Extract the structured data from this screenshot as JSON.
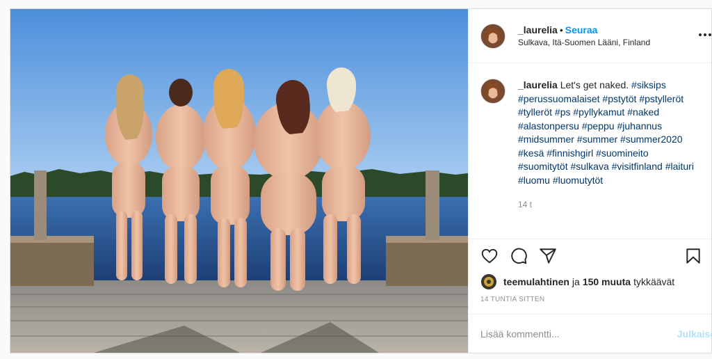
{
  "header": {
    "username": "_laurelia",
    "separator": "•",
    "follow_label": "Seuraa",
    "location": "Sulkava, Itä-Suomen Lääni, Finland",
    "more_icon": "more-horizontal-icon"
  },
  "caption": {
    "username": "_laurelia",
    "text": "Let's get naked.",
    "hashtags": [
      "#siksips",
      "#perussuomalaiset",
      "#pstytöt",
      "#pstylleröt",
      "#tylleröt",
      "#ps",
      "#pyllykamut",
      "#naked",
      "#alastonpersu",
      "#peppu",
      "#juhannus",
      "#midsummer",
      "#summer",
      "#summer2020",
      "#kesä",
      "#finnishgirl",
      "#suomineito",
      "#suomitytöt",
      "#sulkava",
      "#visitfinland",
      "#laituri",
      "#luomu",
      "#luomutytöt"
    ],
    "time": "14 t"
  },
  "actions": {
    "like_icon": "heart-icon",
    "comment_icon": "comment-icon",
    "share_icon": "share-icon",
    "save_icon": "bookmark-icon"
  },
  "likes": {
    "liker": "teemulahtinen",
    "connector": "ja",
    "others": "150 muuta",
    "suffix": "tykkäävät"
  },
  "timestamp": "14 TUNTIA SITTEN",
  "comment_box": {
    "placeholder": "Lisää kommentti...",
    "post_label": "Julkaise"
  },
  "colors": {
    "link_blue": "#0095f6",
    "hashtag": "#00376b",
    "muted": "#8e8e8e",
    "post_disabled": "#b2dffc"
  }
}
